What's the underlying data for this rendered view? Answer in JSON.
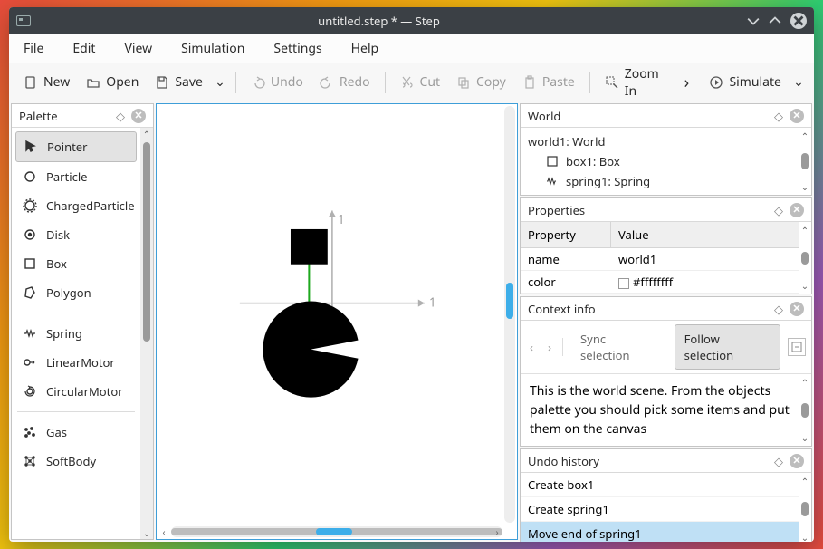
{
  "window": {
    "title": "untitled.step * — Step"
  },
  "menubar": [
    "File",
    "Edit",
    "View",
    "Simulation",
    "Settings",
    "Help"
  ],
  "toolbar": {
    "new": "New",
    "open": "Open",
    "save": "Save",
    "undo": "Undo",
    "redo": "Redo",
    "cut": "Cut",
    "copy": "Copy",
    "paste": "Paste",
    "zoom_in": "Zoom In",
    "simulate": "Simulate"
  },
  "palette": {
    "title": "Palette",
    "items": [
      {
        "label": "Pointer",
        "icon": "pointer",
        "selected": true
      },
      {
        "label": "Particle",
        "icon": "circle"
      },
      {
        "label": "ChargedParticle",
        "icon": "chargedparticle"
      },
      {
        "label": "Disk",
        "icon": "disk"
      },
      {
        "label": "Box",
        "icon": "box"
      },
      {
        "label": "Polygon",
        "icon": "polygon"
      },
      {
        "label": "Spring",
        "icon": "spring"
      },
      {
        "label": "LinearMotor",
        "icon": "linearmotor"
      },
      {
        "label": "CircularMotor",
        "icon": "circularmotor"
      },
      {
        "label": "Gas",
        "icon": "gas"
      },
      {
        "label": "SoftBody",
        "icon": "softbody"
      }
    ]
  },
  "canvas": {
    "axis_x_label": "1",
    "axis_y_label": "1"
  },
  "world": {
    "title": "World",
    "root": "world1: World",
    "children": [
      {
        "label": "box1: Box",
        "icon": "box"
      },
      {
        "label": "spring1: Spring",
        "icon": "spring"
      }
    ]
  },
  "properties": {
    "title": "Properties",
    "col_property": "Property",
    "col_value": "Value",
    "rows": [
      {
        "name": "name",
        "value": "world1"
      },
      {
        "name": "color",
        "value": "#ffffffff"
      }
    ]
  },
  "context": {
    "title": "Context info",
    "sync": "Sync selection",
    "follow": "Follow selection",
    "text": "This is the world scene. From the objects palette you should pick some items and put them on the canvas"
  },
  "undo": {
    "title": "Undo history",
    "items": [
      "Create box1",
      "Create spring1",
      "Move end of spring1"
    ],
    "selected_index": 2
  }
}
